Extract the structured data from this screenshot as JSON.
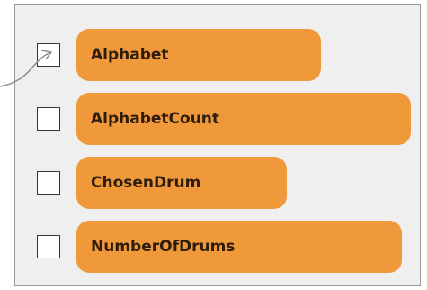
{
  "variables": [
    {
      "name": "Alphabet",
      "checked": false
    },
    {
      "name": "AlphabetCount",
      "checked": false
    },
    {
      "name": "ChosenDrum",
      "checked": false
    },
    {
      "name": "NumberOfDrums",
      "checked": false
    }
  ],
  "colors": {
    "pill": "#f0993b",
    "panel_background": "#efefef",
    "panel_border": "#9a9a9a",
    "checkbox_border": "#333333",
    "connector": "#8a9096"
  }
}
